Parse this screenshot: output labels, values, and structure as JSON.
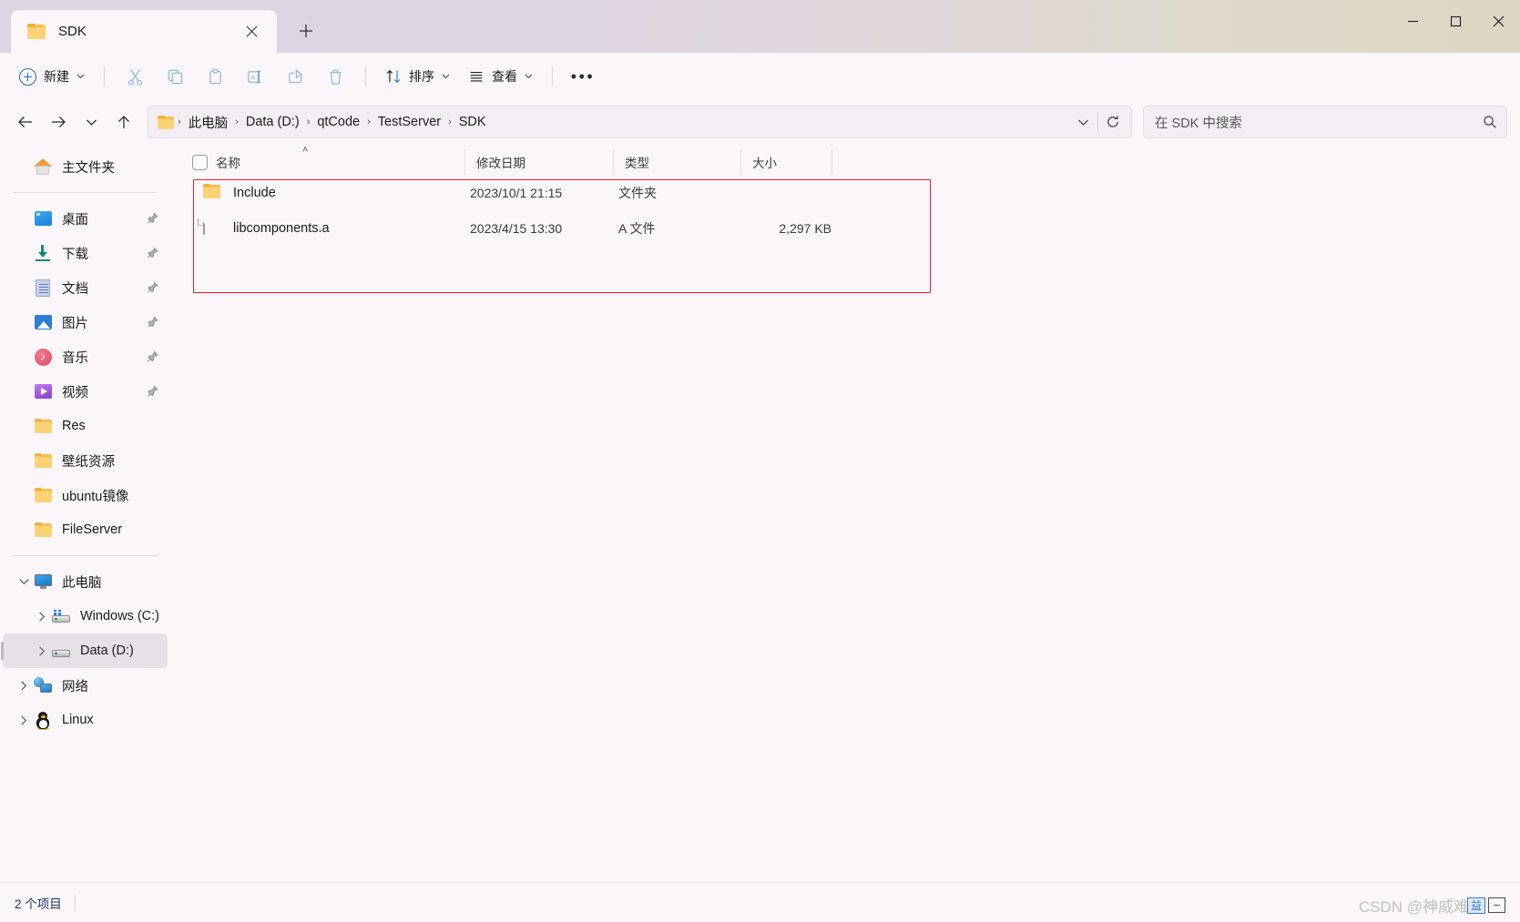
{
  "window": {
    "tab_title": "SDK",
    "controls": {
      "minimize": "—",
      "maximize": "□",
      "close": "✕"
    },
    "new_tab_label": "+",
    "close_tab_label": "✕"
  },
  "toolbar": {
    "new_label": "新建",
    "sort_label": "排序",
    "view_label": "查看",
    "more_label": "•••",
    "chevron": "⌄",
    "icons": [
      {
        "name": "cut-icon",
        "glyph": "✂"
      },
      {
        "name": "copy-icon",
        "glyph": "⧉"
      },
      {
        "name": "paste-icon",
        "glyph": "ὌB"
      },
      {
        "name": "rename-icon",
        "glyph": "A"
      },
      {
        "name": "share-icon",
        "glyph": "↪"
      },
      {
        "name": "delete-icon",
        "glyph": "Ὕ1"
      }
    ]
  },
  "address": {
    "back": "←",
    "forward": "→",
    "recent": "⌄",
    "up": "↑",
    "breadcrumbs": [
      "此电脑",
      "Data (D:)",
      "qtCode",
      "TestServer",
      "SDK"
    ],
    "separator": "›",
    "dropdown": "⌄",
    "refresh": "↻"
  },
  "search": {
    "placeholder": "在 SDK 中搜索",
    "icon": "⌕"
  },
  "sidebar": {
    "home": {
      "label": "主文件夹",
      "icon": "home-icon"
    },
    "quick_access": [
      {
        "label": "桌面",
        "icon": "desktop-icon",
        "pinned": true
      },
      {
        "label": "下载",
        "icon": "download-icon",
        "pinned": true
      },
      {
        "label": "文档",
        "icon": "documents-icon",
        "pinned": true
      },
      {
        "label": "图片",
        "icon": "pictures-icon",
        "pinned": true
      },
      {
        "label": "音乐",
        "icon": "music-icon",
        "pinned": true
      },
      {
        "label": "视频",
        "icon": "video-icon",
        "pinned": true
      },
      {
        "label": "Res",
        "icon": "folder-icon",
        "pinned": false
      },
      {
        "label": "壁纸资源",
        "icon": "folder-icon",
        "pinned": false
      },
      {
        "label": "ubuntu镜像",
        "icon": "folder-icon",
        "pinned": false
      },
      {
        "label": "FileServer",
        "icon": "folder-icon",
        "pinned": false
      }
    ],
    "tree": [
      {
        "label": "此电脑",
        "icon": "this-pc-icon",
        "expander": "⌄",
        "expanded": true,
        "indent": 0,
        "selected": false
      },
      {
        "label": "Windows (C:)",
        "icon": "drive-windows-icon",
        "expander": "›",
        "expanded": false,
        "indent": 1,
        "selected": false
      },
      {
        "label": "Data (D:)",
        "icon": "drive-icon",
        "expander": "›",
        "expanded": false,
        "indent": 1,
        "selected": true
      },
      {
        "label": "网络",
        "icon": "network-icon",
        "expander": "›",
        "expanded": false,
        "indent": 0,
        "selected": false
      },
      {
        "label": "Linux",
        "icon": "linux-icon",
        "expander": "›",
        "expanded": false,
        "indent": 0,
        "selected": false
      }
    ],
    "pin_glyph": "➘"
  },
  "filelist": {
    "select_all_checkbox": false,
    "sort_indicator": "˄",
    "columns": [
      {
        "key": "name",
        "label": "名称"
      },
      {
        "key": "date",
        "label": "修改日期"
      },
      {
        "key": "type",
        "label": "类型"
      },
      {
        "key": "size",
        "label": "大小"
      }
    ],
    "rows": [
      {
        "name": "Include",
        "date": "2023/10/1 21:15",
        "type": "文件夹",
        "size": "",
        "icon": "folder-icon"
      },
      {
        "name": "libcomponents.a",
        "date": "2023/4/15 13:30",
        "type": "A 文件",
        "size": "2,297 KB",
        "icon": "file-icon"
      }
    ]
  },
  "annotation": {
    "color": "#ee1c24"
  },
  "statusbar": {
    "item_count": "2 个项目"
  },
  "watermark": {
    "text": "CSDN @神威难避",
    "badge": "益",
    "box": "∼"
  }
}
